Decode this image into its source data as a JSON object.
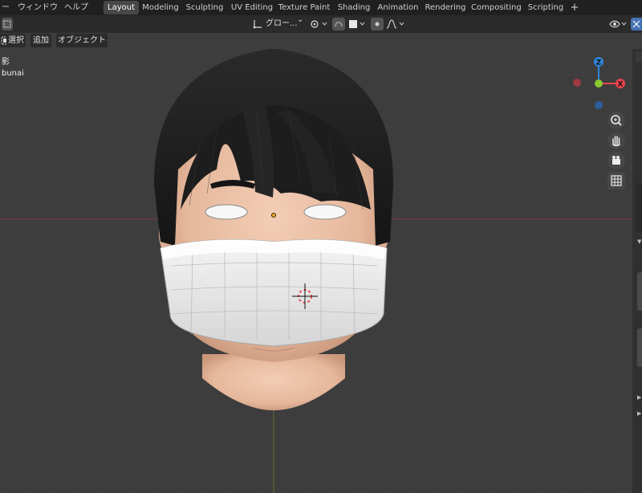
{
  "menu": {
    "dash": "ー",
    "window": "ウィンドウ",
    "help": "ヘルプ"
  },
  "workspace_tabs": [
    {
      "label": "Layout",
      "active": true
    },
    {
      "label": "Modeling",
      "active": false
    },
    {
      "label": "Sculpting",
      "active": false
    },
    {
      "label": "UV Editing",
      "active": false
    },
    {
      "label": "Texture Paint",
      "active": false
    },
    {
      "label": "Shading",
      "active": false
    },
    {
      "label": "Animation",
      "active": false
    },
    {
      "label": "Rendering",
      "active": false
    },
    {
      "label": "Compositing",
      "active": false
    },
    {
      "label": "Scripting",
      "active": false
    }
  ],
  "add_workspace": "+",
  "header": {
    "transform_orientation": "グロー...",
    "dropdown_chevron": "⌄"
  },
  "viewport_menu": {
    "select": "選択",
    "add": "追加",
    "object": "オブジェクト"
  },
  "overlay": {
    "line1": "影",
    "line2": "bunai"
  },
  "gizmo": {
    "z": "Z",
    "x": "X",
    "colors": {
      "x": "#e8434e",
      "y": "#8bc832",
      "z": "#2f85d8",
      "neg": "#9e3a40",
      "negz": "#2f5e9a"
    }
  },
  "icons": {
    "zoom": "zoom-icon",
    "pan": "hand-icon",
    "camera": "camera-icon",
    "grid": "grid-icon"
  }
}
